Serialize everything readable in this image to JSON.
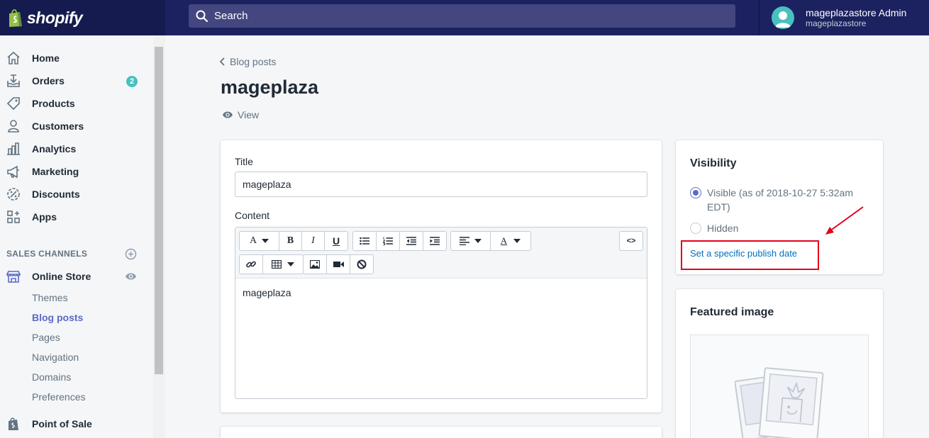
{
  "app": {
    "logo_text": "shopify"
  },
  "search": {
    "placeholder": "Search"
  },
  "user": {
    "name": "mageplazastore Admin",
    "store": "mageplazastore"
  },
  "sidebar": {
    "items": [
      {
        "label": "Home",
        "icon": "home-icon"
      },
      {
        "label": "Orders",
        "icon": "orders-icon",
        "badge": "2"
      },
      {
        "label": "Products",
        "icon": "tag-icon"
      },
      {
        "label": "Customers",
        "icon": "person-icon"
      },
      {
        "label": "Analytics",
        "icon": "bar-chart-icon"
      },
      {
        "label": "Marketing",
        "icon": "megaphone-icon"
      },
      {
        "label": "Discounts",
        "icon": "discount-icon"
      },
      {
        "label": "Apps",
        "icon": "apps-icon"
      }
    ],
    "sales_channels_heading": "SALES CHANNELS",
    "online_store": {
      "label": "Online Store",
      "icon": "store-icon"
    },
    "sub_items": [
      {
        "label": "Themes"
      },
      {
        "label": "Blog posts",
        "active": true
      },
      {
        "label": "Pages"
      },
      {
        "label": "Navigation"
      },
      {
        "label": "Domains"
      },
      {
        "label": "Preferences"
      }
    ],
    "point_of_sale": {
      "label": "Point of Sale",
      "icon": "shopify-bag-icon"
    }
  },
  "main": {
    "breadcrumb": "Blog posts",
    "title": "mageplaza",
    "view_label": "View",
    "form": {
      "title_label": "Title",
      "title_value": "mageplaza",
      "content_label": "Content",
      "content_value": "mageplaza",
      "toolbar": {
        "font_button": "A",
        "bold": "B",
        "italic": "I",
        "underline": "U",
        "html_button": "<>",
        "text_color": "A"
      }
    }
  },
  "visibility": {
    "title": "Visibility",
    "visible_label": "Visible (as of 2018-10-27 5:32am EDT)",
    "visible_line1": "Visible (as of 2018-10-27 5:32am",
    "visible_line2": "EDT)",
    "hidden_label": "Hidden",
    "selected": "visible",
    "publish_link": "Set a specific publish date"
  },
  "featured_image": {
    "title": "Featured image"
  },
  "colors": {
    "topbar": "#1c2260",
    "accent": "#5c6ac4",
    "link": "#006fbb",
    "annotation": "#e3001b",
    "badge": "#47c1bf"
  }
}
